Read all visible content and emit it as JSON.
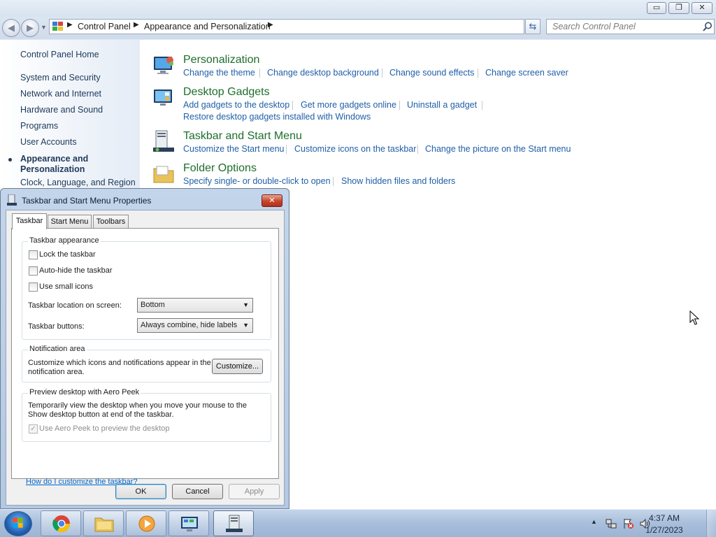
{
  "window": {
    "minimize_glyph": "▭",
    "maximize_glyph": "❐",
    "close_glyph": "✕"
  },
  "address": {
    "breadcrumb": [
      "Control Panel",
      "Appearance and Personalization"
    ],
    "search_placeholder": "Search Control Panel"
  },
  "sidebar": {
    "home": "Control Panel Home",
    "items": [
      "System and Security",
      "Network and Internet",
      "Hardware and Sound",
      "Programs",
      "User Accounts"
    ],
    "current": "Appearance and Personalization",
    "after_items": [
      "Clock, Language, and Region"
    ]
  },
  "categories": [
    {
      "title": "Personalization",
      "icon": "personalization-icon",
      "links": [
        "Change the theme",
        "Change desktop background",
        "Change sound effects",
        "Change screen saver"
      ]
    },
    {
      "title": "Desktop Gadgets",
      "icon": "desktop-gadgets-icon",
      "links": [
        "Add gadgets to the desktop",
        "Get more gadgets online",
        "Uninstall a gadget"
      ],
      "links2": [
        "Restore desktop gadgets installed with Windows"
      ]
    },
    {
      "title": "Taskbar and Start Menu",
      "icon": "taskbar-start-menu-icon",
      "links": [
        "Customize the Start menu",
        "Customize icons on the taskbar",
        "Change the picture on the Start menu"
      ]
    },
    {
      "title": "Folder Options",
      "icon": "folder-options-icon",
      "links": [
        "Specify single- or double-click to open",
        "Show hidden files and folders"
      ]
    }
  ],
  "dialog": {
    "title": "Taskbar and Start Menu Properties",
    "tabs": [
      "Taskbar",
      "Start Menu",
      "Toolbars"
    ],
    "active_tab": "Taskbar",
    "appearance": {
      "title": "Taskbar appearance",
      "lock": {
        "label": "Lock the taskbar",
        "checked": false
      },
      "autohide": {
        "label": "Auto-hide the taskbar",
        "checked": false
      },
      "small_icons": {
        "label": "Use small icons",
        "checked": false
      },
      "location_label": "Taskbar location on screen:",
      "location_value": "Bottom",
      "buttons_label": "Taskbar buttons:",
      "buttons_value": "Always combine, hide labels"
    },
    "notification": {
      "title": "Notification area",
      "text": "Customize which icons and notifications appear in the notification area.",
      "button": "Customize..."
    },
    "aero": {
      "title": "Preview desktop with Aero Peek",
      "text": "Temporarily view the desktop when you move your mouse to the Show desktop button at end of the taskbar.",
      "checkbox": {
        "label": "Use Aero Peek to preview the desktop",
        "checked": true,
        "disabled": true
      }
    },
    "help_link": "How do I customize the taskbar?",
    "ok": "OK",
    "cancel": "Cancel",
    "apply": "Apply"
  },
  "taskbar": {
    "pinned": [
      "chrome-icon",
      "explorer-icon",
      "media-player-icon",
      "control-panel-icon",
      "taskbar-properties-icon"
    ],
    "clock_time": "4:37 AM",
    "clock_date": "1/27/2023",
    "tray_icons": [
      "show-hidden-icons-icon",
      "network-icon",
      "action-center-icon",
      "volume-icon"
    ]
  },
  "colors": {
    "link": "#1f5fa8",
    "category_title": "#1e6e2c",
    "sidebar_text": "#1e395b",
    "help_link": "#0066cc"
  }
}
